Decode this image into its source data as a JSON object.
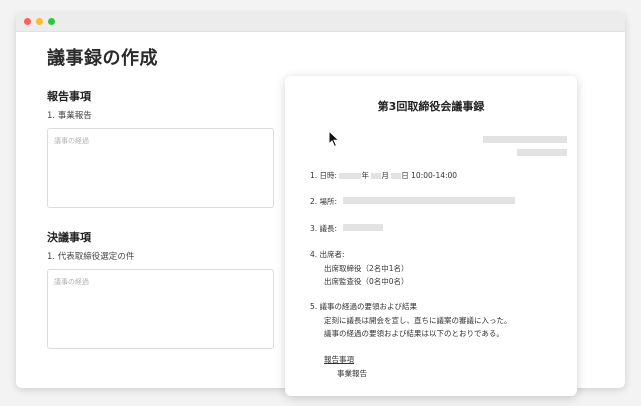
{
  "page": {
    "title": "議事録の作成"
  },
  "form": {
    "report_heading": "報告事項",
    "report_item": "1. 事業報告",
    "report_placeholder": "議事の経過",
    "resolution_heading": "決議事項",
    "resolution_item": "1. 代表取締役選定の件",
    "resolution_placeholder": "議事の経過"
  },
  "doc": {
    "title": "第3回取締役会議事録",
    "date_label": "1. 日時:",
    "date_year": "年",
    "date_month": "月",
    "date_day": "日",
    "date_time": "10:00-14:00",
    "place_label": "2. 場所:",
    "chair_label": "3. 議長:",
    "attendees_label": "4. 出席者:",
    "attendees_directors": "出席取締役（2名中1名）",
    "attendees_auditors": "出席監査役（0名中0名）",
    "proceedings_label": "5. 議事の経過の要領および結果",
    "proceedings_line1": "定刻に議長は開会を宣し、直ちに議案の審議に入った。",
    "proceedings_line2": "議事の経過の要領および結果は以下のとおりである。",
    "report_heading": "報告事項",
    "report_item": "事業報告"
  },
  "colors": {
    "window_bg": "#ffffff",
    "titlebar": "#ececec",
    "close": "#fe5f57",
    "minimize": "#febc2e",
    "zoom": "#28c840",
    "redacted": "#e2e2e2"
  },
  "icons": {
    "cursor": "mouse-pointer-icon"
  }
}
